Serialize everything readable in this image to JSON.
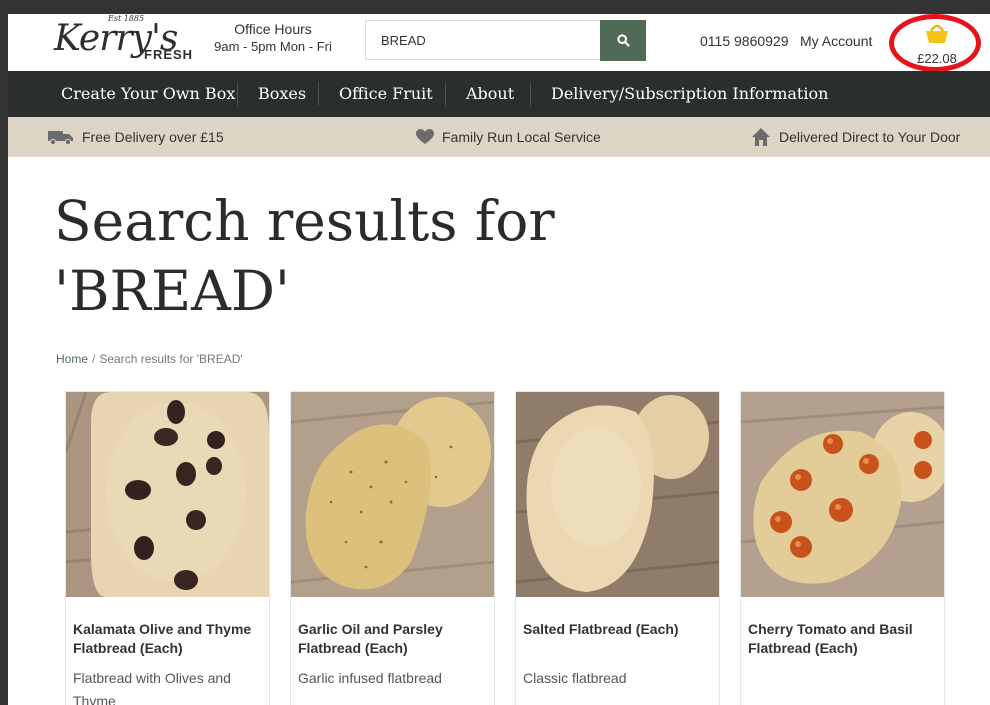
{
  "header": {
    "logo": {
      "est": "Est 1885",
      "script": "Kerry's",
      "fresh": "FRESH"
    },
    "office_hours_title": "Office Hours",
    "office_hours_times": "9am - 5pm Mon - Fri",
    "search": {
      "value": "BREAD"
    },
    "phone": "0115 9860929",
    "account_label": "My Account",
    "cart_total": "£22.08",
    "cart_ring_color": "#e5141b"
  },
  "nav": {
    "items": [
      {
        "label": "Create Your Own Box"
      },
      {
        "label": "Boxes"
      },
      {
        "label": "Office Fruit"
      },
      {
        "label": "About"
      },
      {
        "label": "Delivery/Subscription Information"
      }
    ]
  },
  "benefits": {
    "items": [
      {
        "label": "Free Delivery over £15",
        "icon": "delivery-truck-icon"
      },
      {
        "label": "Family Run Local Service",
        "icon": "heart-icon"
      },
      {
        "label": "Delivered Direct to Your Door",
        "icon": "house-icon"
      }
    ]
  },
  "page": {
    "title_line1": "Search results for",
    "title_line2": "'BREAD'"
  },
  "breadcrumb": {
    "home": "Home",
    "separator": "/",
    "current": "Search results for 'BREAD'"
  },
  "products": [
    {
      "name": "Kalamata Olive and Thyme Flatbread (Each)",
      "description": "Flatbread with Olives and Thyme"
    },
    {
      "name": "Garlic Oil and Parsley Flatbread (Each)",
      "description": "Garlic infused flatbread"
    },
    {
      "name": "Salted Flatbread (Each)",
      "description": "Classic flatbread"
    },
    {
      "name": "Cherry Tomato and Basil Flatbread (Each)",
      "description": ""
    }
  ],
  "colors": {
    "nav_bg": "#2a2e2c",
    "benefit_bar_bg": "#ded4c6",
    "accent_green": "#4f6b58"
  }
}
